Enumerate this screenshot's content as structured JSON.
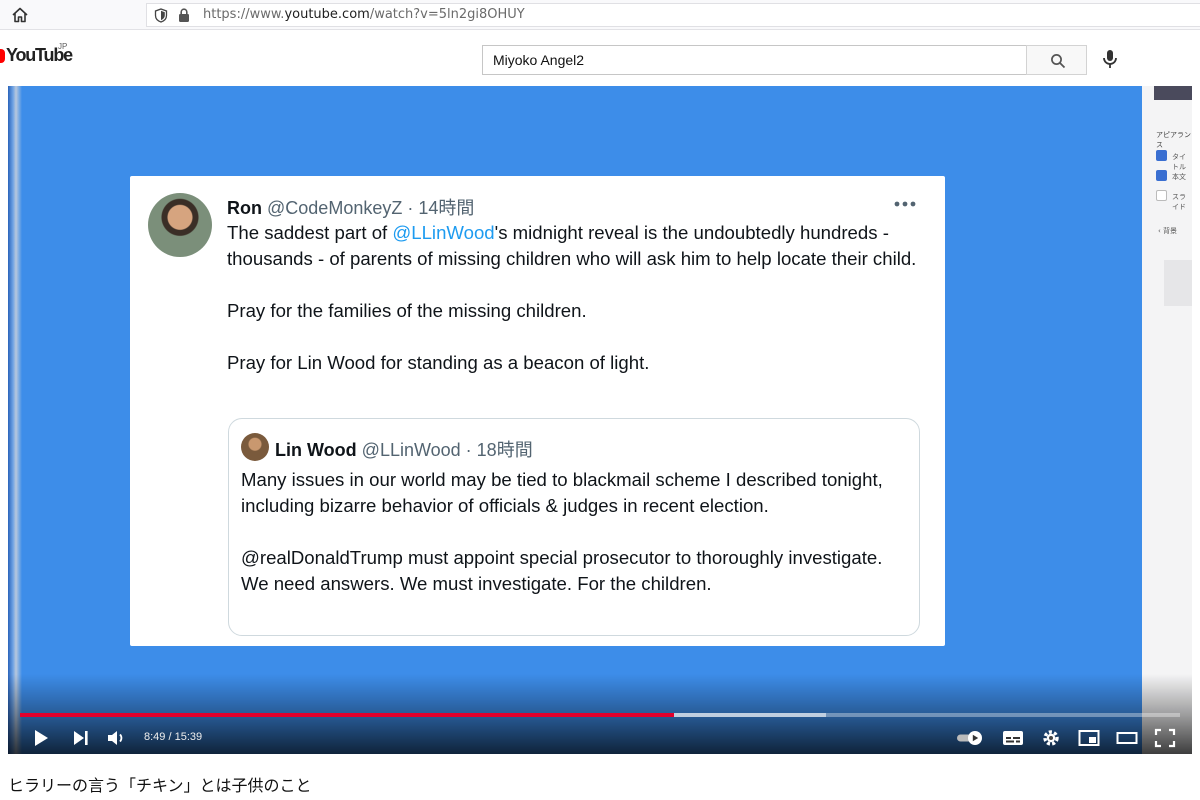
{
  "browser": {
    "url_prefix": "https://www.",
    "url_domain": "youtube.com",
    "url_path": "/watch?v=5ln2gi8OHUY"
  },
  "youtube_header": {
    "logo_text": "YouTube",
    "region": "JP",
    "search_value": "Miyoko Angel2"
  },
  "tweet": {
    "author_name": "Ron",
    "author_handle": "@CodeMonkeyZ",
    "separator": " · ",
    "time": "14時間",
    "line1_before": "The saddest part of ",
    "line1_mention": "@LLinWood",
    "line1_after": "'s midnight reveal is the undoubtedly hundreds - thousands - of parents of missing children who will ask him to help locate their child.",
    "paragraph2": "Pray for the families of the missing children.",
    "paragraph3": "Pray for Lin Wood for standing as a beacon of light."
  },
  "quote": {
    "author_name": "Lin Wood",
    "author_handle": "@LLinWood",
    "separator": " · ",
    "time": "18時間",
    "paragraph1": "Many issues in our world may be tied to blackmail scheme I described tonight, including bizarre behavior of officials & judges in recent election.",
    "paragraph2": "@realDonaldTrump must appoint special prosecutor to thoroughly investigate. We need answers. We must investigate. For the children."
  },
  "side_panel": {
    "title": "アピアランス",
    "items": [
      {
        "label": "タイトル",
        "checked": true
      },
      {
        "label": "本文",
        "checked": true
      },
      {
        "label": "スライド",
        "checked": false
      }
    ],
    "back_label": "‹ 背景"
  },
  "player": {
    "time_current": "8:49",
    "time_separator": " / ",
    "time_total": "15:39",
    "played_fraction": 0.564,
    "buffered_fraction": 0.695,
    "colors": {
      "progress": "#e1002d",
      "screen_background": "#3d8de9"
    }
  },
  "video": {
    "title": "ヒラリーの言う「チキン」とは子供のこと"
  }
}
